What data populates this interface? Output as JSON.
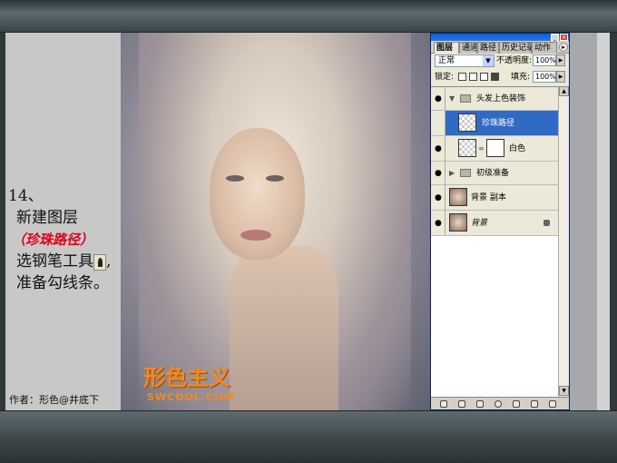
{
  "tutorial": {
    "step_number": "14、",
    "lines": [
      "新建图层",
      "（珍珠路径）",
      "选钢笔工具",
      "准备勾线条。"
    ],
    "tool_icon": "pen-tool-icon",
    "author": "作者：形色@井底下"
  },
  "watermark": {
    "main": "形色主义",
    "sub": "SWCOOL.COM"
  },
  "layers_panel": {
    "tabs": [
      "图层",
      "通道",
      "路径",
      "历史记录",
      "动作"
    ],
    "blend_mode": "正常",
    "opacity_label": "不透明度:",
    "opacity_value": "100%",
    "lock_label": "锁定:",
    "fill_label": "填充:",
    "fill_value": "100%",
    "layers": [
      {
        "name": "头发上色装饰",
        "kind": "group",
        "expanded": true
      },
      {
        "name": "珍珠路径",
        "kind": "layer",
        "selected": true
      },
      {
        "name": "白色",
        "kind": "adjustment"
      },
      {
        "name": "初级准备",
        "kind": "group",
        "expanded": false
      },
      {
        "name": "背景 副本",
        "kind": "layer"
      },
      {
        "name": "背景",
        "kind": "background",
        "locked": true
      }
    ],
    "accent_color": "#316ac5"
  }
}
